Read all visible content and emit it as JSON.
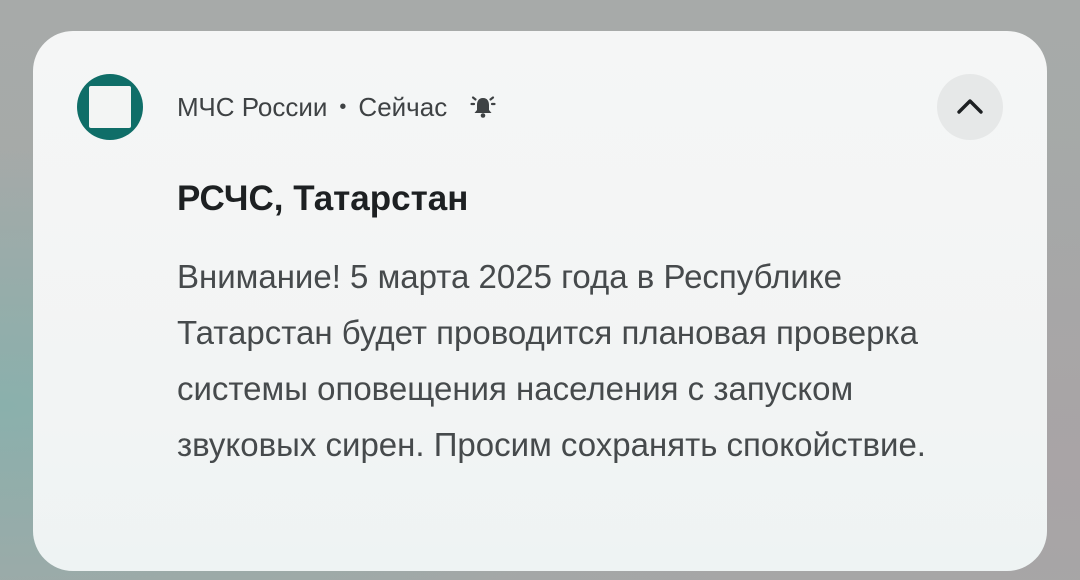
{
  "notification": {
    "app_name": "МЧС России",
    "separator": "•",
    "time": "Сейчас",
    "title": "РСЧС, Татарстан",
    "message": "Внимание! 5 марта 2025 года в Республике Татарстан будет проводится плановая проверка системы оповещения населения с запуском звуковых сирен. Просим сохранять спокойствие.",
    "icons": {
      "app": "mchs-logo-icon",
      "alert": "bell-ringing-icon",
      "expand": "chevron-up-icon"
    },
    "colors": {
      "app_icon": "#0f6e68",
      "card_bg": "#f5f6f6"
    }
  }
}
